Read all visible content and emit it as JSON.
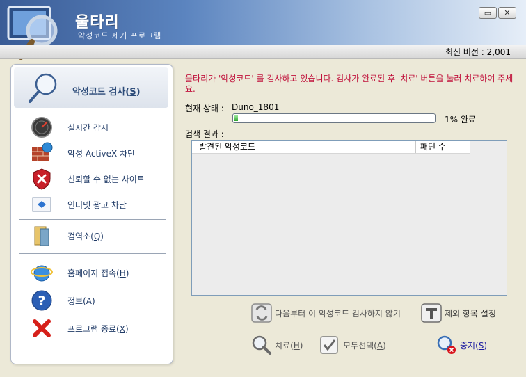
{
  "window": {
    "title": "울타리",
    "subtitle": "악성코드 제거 프로그램",
    "minimize_glyph": "▭",
    "close_glyph": "✕"
  },
  "version": {
    "text": "최신 버전 : 2,001"
  },
  "sidebar": {
    "scan": {
      "label": "악성코드 검사(S)",
      "icon": "magnifier-icon"
    },
    "items": [
      {
        "label": "실시간 감시",
        "icon": "radar-icon"
      },
      {
        "label": "악성 ActiveX 차단",
        "icon": "brick-wall-globe-icon"
      },
      {
        "label": "신뢰할 수 없는 사이트",
        "icon": "red-shield-icon"
      },
      {
        "label": "인터넷 광고 차단",
        "icon": "ad-block-icon"
      },
      {
        "label": "검역소(Q)",
        "icon": "quarantine-icon"
      },
      {
        "label": "홈페이지 접속(H)",
        "icon": "ie-globe-icon"
      },
      {
        "label": "정보(A)",
        "icon": "help-icon"
      },
      {
        "label": "프로그램 종료(X)",
        "icon": "red-x-icon"
      }
    ]
  },
  "main": {
    "message": "울타리가 '악성코드' 를 검사하고 있습니다. 검사가 완료된 후 '치료' 버튼을 눌러 치료하여 주세요.",
    "status_label": "현재 상태 :",
    "status_value": "Duno_1801",
    "progress_percent": 1,
    "progress_text": "1% 완료",
    "results_label": "검색 결과 :",
    "columns": [
      "발견된 악성코드",
      "패턴 수"
    ],
    "rows": []
  },
  "actions": {
    "skip": "다음부터 이 악성코드 검사하지 않기",
    "exclude": "제외 항목 설정",
    "heal": "치료(H)",
    "select_all": "모두선택(A)",
    "stop": "중지(S)"
  },
  "colors": {
    "accent_red": "#c0103a",
    "header_blue": "#3a5c96",
    "nav_text": "#1f3a66"
  }
}
